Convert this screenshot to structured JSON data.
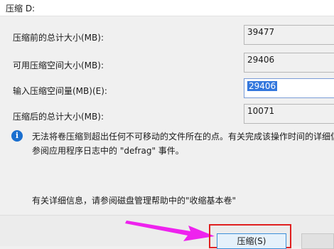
{
  "header": {
    "title": "压缩 D:"
  },
  "rows": [
    {
      "label": "压缩前的总计大小(MB):",
      "value": "39477"
    },
    {
      "label": "可用压缩空间大小(MB):",
      "value": "29406"
    },
    {
      "label": "输入压缩空间量(MB)(E):",
      "value": "29406"
    },
    {
      "label": "压缩后的总计大小(MB):",
      "value": "10071"
    }
  ],
  "info": {
    "line1": "无法将卷压缩到超出任何不可移动的文件所在的点。有关完成该操作时间的详细信息",
    "line2": "参阅应用程序日志中的 \"defrag\" 事件。"
  },
  "detail_text": "有关详细信息，请参阅磁盘管理帮助中的\"收缩基本卷\"",
  "buttons": {
    "shrink": "压缩(S)"
  },
  "colors": {
    "annotation_arrow": "#ee22ee",
    "annotation_box": "#e02020",
    "accent": "#3377dd"
  }
}
